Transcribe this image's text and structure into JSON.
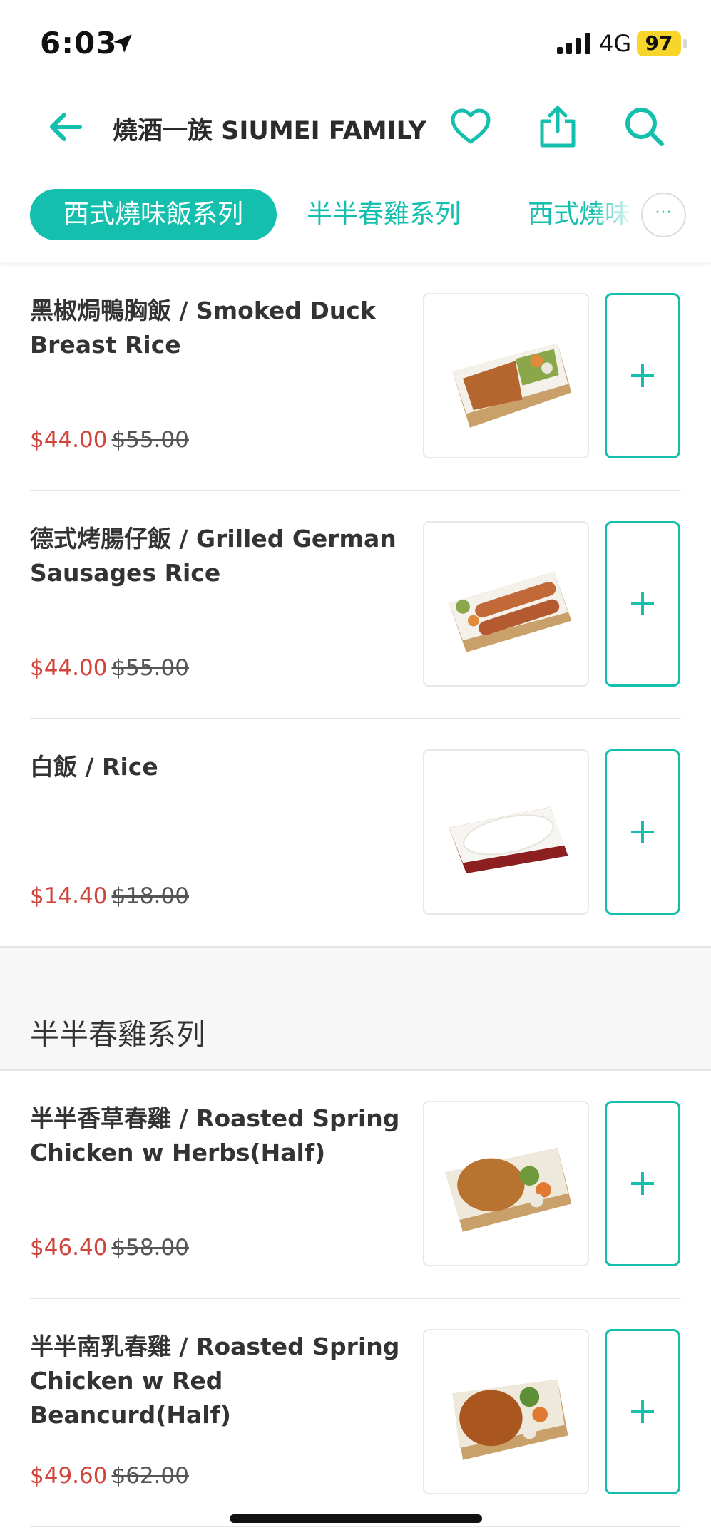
{
  "status_bar": {
    "time": "6:03",
    "network": "4G",
    "battery": "97"
  },
  "header": {
    "title": "燒酒一族 SIUMEI FAMILY"
  },
  "tabs": [
    {
      "label": "西式燒味飯系列",
      "active": true
    },
    {
      "label": "半半春雞系列",
      "active": false
    },
    {
      "label": "西式燒味",
      "active": false
    }
  ],
  "more_label": "···",
  "accent_color": "#15bfae",
  "price_color": "#d0453b",
  "items": [
    {
      "name": "黑椒焗鴨胸飯 / Smoked Duck Breast Rice",
      "price": "$44.00",
      "old_price": "$55.00"
    },
    {
      "name": "德式烤腸仔飯 / Grilled German Sausages Rice",
      "price": "$44.00",
      "old_price": "$55.00"
    },
    {
      "name": "白飯 / Rice",
      "price": "$14.40",
      "old_price": "$18.00"
    }
  ],
  "section": {
    "title": "半半春雞系列",
    "items": [
      {
        "name": "半半香草春雞 / Roasted Spring Chicken w Herbs(Half)",
        "price": "$46.40",
        "old_price": "$58.00"
      },
      {
        "name": "半半南乳春雞 / Roasted Spring Chicken w Red Beancurd(Half)",
        "price": "$49.60",
        "old_price": "$62.00"
      }
    ]
  }
}
